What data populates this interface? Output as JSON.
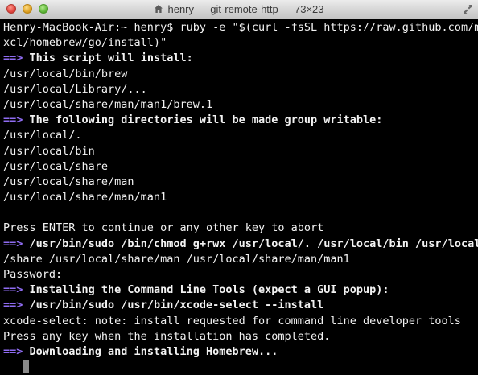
{
  "window": {
    "title": "henry — git-remote-http — 73×23"
  },
  "terminal": {
    "lines": [
      {
        "type": "plain",
        "text": "Henry-MacBook-Air:~ henry$ ruby -e \"$(curl -fsSL https://raw.github.com/m"
      },
      {
        "type": "plain",
        "text": "xcl/homebrew/go/install)\""
      },
      {
        "type": "arrow",
        "arrow": "==>",
        "text": " This script will install:"
      },
      {
        "type": "plain",
        "text": "/usr/local/bin/brew"
      },
      {
        "type": "plain",
        "text": "/usr/local/Library/..."
      },
      {
        "type": "plain",
        "text": "/usr/local/share/man/man1/brew.1"
      },
      {
        "type": "arrow",
        "arrow": "==>",
        "text": " The following directories will be made group writable:"
      },
      {
        "type": "plain",
        "text": "/usr/local/."
      },
      {
        "type": "plain",
        "text": "/usr/local/bin"
      },
      {
        "type": "plain",
        "text": "/usr/local/share"
      },
      {
        "type": "plain",
        "text": "/usr/local/share/man"
      },
      {
        "type": "plain",
        "text": "/usr/local/share/man/man1"
      },
      {
        "type": "plain",
        "text": ""
      },
      {
        "type": "plain",
        "text": "Press ENTER to continue or any other key to abort"
      },
      {
        "type": "arrow",
        "arrow": "==>",
        "text": " /usr/bin/sudo /bin/chmod g+rwx /usr/local/. /usr/local/bin /usr/local"
      },
      {
        "type": "plain",
        "text": "/share /usr/local/share/man /usr/local/share/man/man1"
      },
      {
        "type": "plain",
        "text": "Password:"
      },
      {
        "type": "arrow",
        "arrow": "==>",
        "text": " Installing the Command Line Tools (expect a GUI popup):"
      },
      {
        "type": "arrow",
        "arrow": "==>",
        "text": " /usr/bin/sudo /usr/bin/xcode-select --install"
      },
      {
        "type": "plain",
        "text": "xcode-select: note: install requested for command line developer tools"
      },
      {
        "type": "plain",
        "text": "Press any key when the installation has completed."
      },
      {
        "type": "arrow",
        "arrow": "==>",
        "text": " Downloading and installing Homebrew..."
      }
    ]
  },
  "icons": {
    "home": "home-icon",
    "fullscreen": "fullscreen-icon"
  },
  "colors": {
    "arrow": "#8f6cf2",
    "text": "#f2f2f2",
    "background": "#000000",
    "cursor": "#8a8a8a"
  }
}
